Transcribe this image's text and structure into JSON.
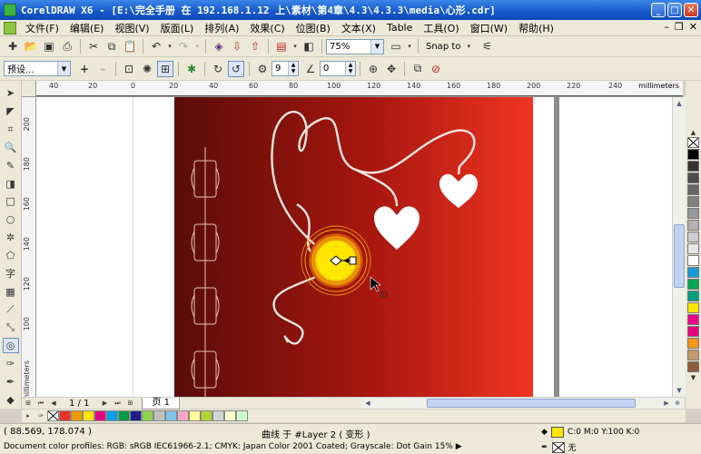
{
  "app": {
    "title": "CorelDRAW X6 - [E:\\完全手册 在 192.168.1.12 上\\素材\\第4章\\4.3\\4.3.3\\media\\心形.cdr]"
  },
  "menu": {
    "items": [
      "文件(F)",
      "编辑(E)",
      "视图(V)",
      "版面(L)",
      "排列(A)",
      "效果(C)",
      "位图(B)",
      "文本(X)",
      "Table",
      "工具(O)",
      "窗口(W)",
      "帮助(H)"
    ]
  },
  "toolbar": {
    "zoom_value": "75%",
    "snap_label": "Snap to"
  },
  "property_bar": {
    "preset_value": "预设...",
    "steps_value": "9",
    "angle_value": "0"
  },
  "rulers": {
    "unit": "millimeters",
    "top_labels": [
      "40",
      "20",
      "0",
      "20",
      "40",
      "60",
      "80",
      "100",
      "120",
      "140",
      "160",
      "180",
      "200",
      "220",
      "240"
    ],
    "left_labels": [
      "200",
      "180",
      "160",
      "140",
      "120",
      "100"
    ],
    "left_unit": "millimeters"
  },
  "page_nav": {
    "counter": "1 / 1",
    "tab": "页 1"
  },
  "status": {
    "coords": "( 88.569, 178.074 )",
    "object_info": "曲线 于 #Layer 2  ( 变形 )",
    "color_profile": "Document color profiles: RGB: sRGB IEC61966-2.1; CMYK: Japan Color 2001 Coated; Grayscale: Dot Gain 15%",
    "fill_text": "C:0 M:0 Y:100 K:0",
    "outline_text": "无"
  },
  "colors": {
    "fill_swatch": "#ffe600",
    "titlebar": "#1557c9"
  },
  "palette": {
    "colors": [
      "#ffffff",
      "#000000",
      "#333333",
      "#4d4d4d",
      "#666666",
      "#808080",
      "#999999",
      "#b3b3b3",
      "#cccccc",
      "#e6e6e6",
      "#ffffff",
      "#1a9cd8",
      "#00a651",
      "#009e7e",
      "#ffe600",
      "#ec008c",
      "#e4007f",
      "#f7941d",
      "#c49a6c",
      "#8b5e3c"
    ]
  },
  "doc_palette": {
    "colors": [
      "#e6332a",
      "#f39800",
      "#ffe600",
      "#e4007f",
      "#00a0e9",
      "#009944",
      "#1d2088",
      "#92d050",
      "#c0c0c0",
      "#7cc6ea",
      "#f5a9c5",
      "#fff799",
      "#b2d235",
      "#d3d3d3",
      "#ffffcc",
      "#ccffcc"
    ]
  }
}
